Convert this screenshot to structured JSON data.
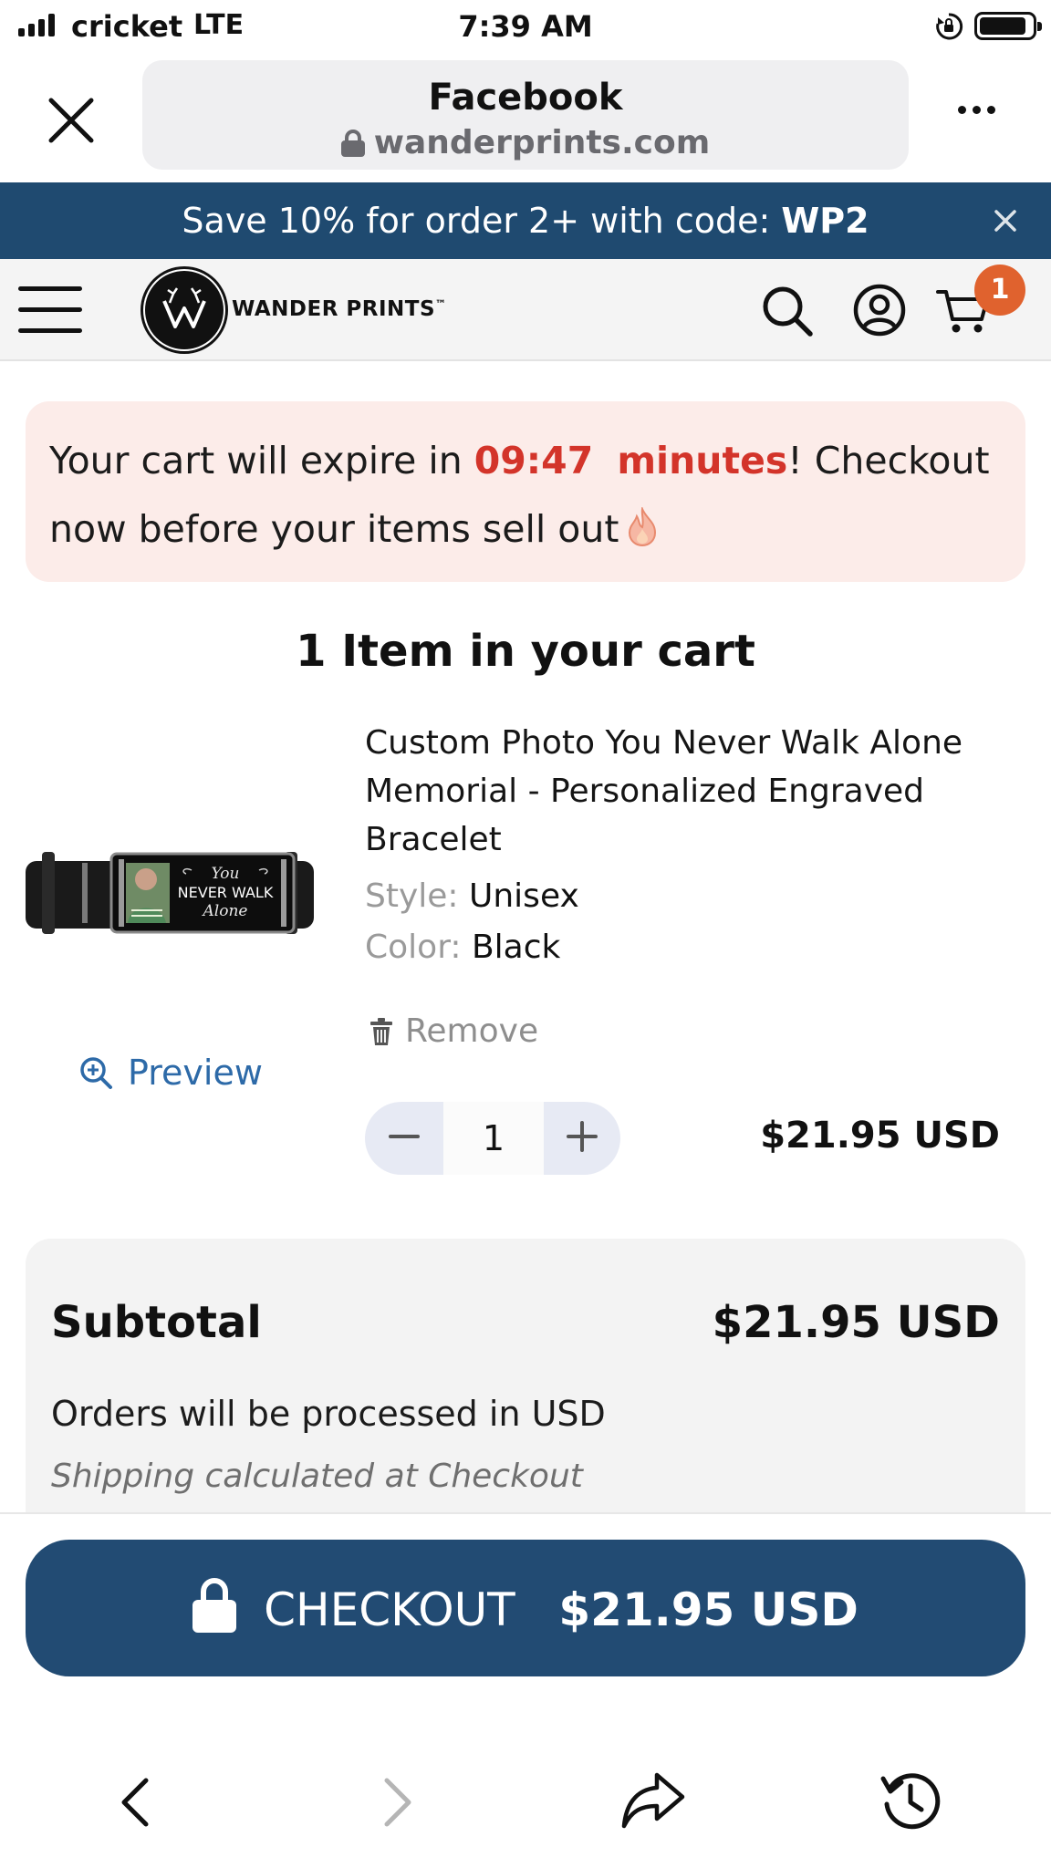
{
  "status_bar": {
    "carrier": "cricket",
    "network": "LTE",
    "time": "7:39 AM"
  },
  "browser": {
    "title": "Facebook",
    "domain": "wanderprints.com"
  },
  "promo": {
    "text": "Save 10% for order 2+ with code: ",
    "code": "WP2"
  },
  "site_header": {
    "brand": "WANDER PRINTS",
    "trademark": "™",
    "cart_count": "1"
  },
  "expiry_notice": {
    "prefix": "Your cart will expire in ",
    "timer": "09:47",
    "unit": "minutes",
    "suffix": "! Checkout now before your items sell out"
  },
  "cart": {
    "heading": "1 Item in your cart",
    "preview_label": "Preview",
    "item": {
      "title": "Custom Photo You Never Walk Alone Memorial - Personalized Engraved Bracelet",
      "style_label": "Style:",
      "style_value": "Unisex",
      "color_label": "Color:",
      "color_value": "Black",
      "remove_label": "Remove",
      "quantity": "1",
      "price": "$21.95 USD",
      "engraving_lines": [
        "You",
        "NEVER WALK",
        "Alone"
      ]
    }
  },
  "summary": {
    "subtotal_label": "Subtotal",
    "subtotal_value": "$21.95 USD",
    "currency_note": "Orders will be processed in USD",
    "shipping_note": "Shipping calculated at Checkout"
  },
  "checkout": {
    "label": "CHECKOUT",
    "amount": "$21.95 USD"
  },
  "colors": {
    "brand_navy": "#1f4a70",
    "timer_red": "#d3342a",
    "badge_orange": "#e0622e",
    "link_blue": "#2d6aa8",
    "notice_bg": "#fcece9"
  },
  "icons": [
    "close-icon",
    "lock-icon",
    "more-icon",
    "banner-close-icon",
    "menu-icon",
    "search-icon",
    "account-icon",
    "cart-icon",
    "flame-icon",
    "zoom-in-icon",
    "trash-icon",
    "minus-icon",
    "plus-icon",
    "back-icon",
    "forward-icon",
    "share-icon",
    "history-icon"
  ]
}
